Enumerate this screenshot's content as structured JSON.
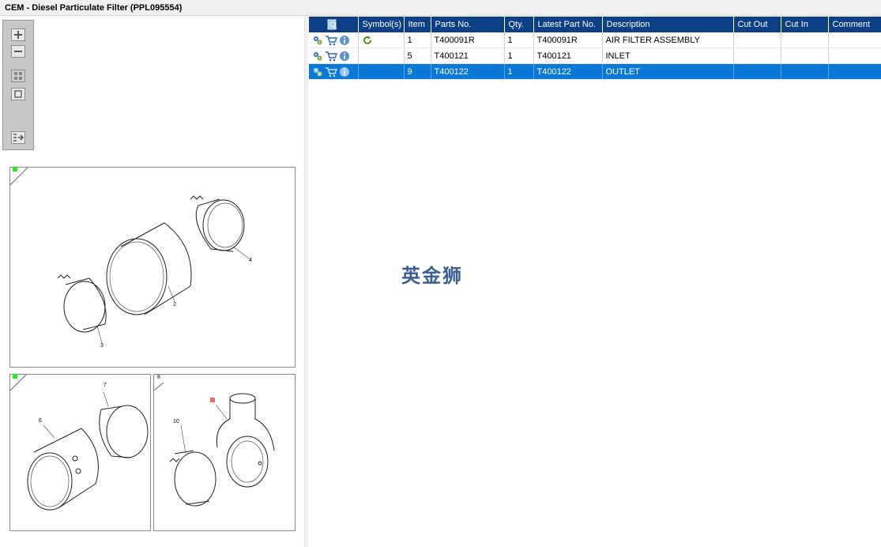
{
  "window": {
    "title": "CEM - Diesel Particulate Filter (PPL095554)"
  },
  "toolbar": {
    "zoom_in_icon": "plus-icon",
    "zoom_out_icon": "minus-icon",
    "fit_all_icon": "grid-icon",
    "fit_one_icon": "square-icon",
    "list_icon": "list-arrow-icon"
  },
  "diagram": {
    "panel1": {
      "callouts": [
        "4",
        "2",
        "3"
      ]
    },
    "panel2": {
      "callouts": [
        "7",
        "6"
      ]
    },
    "panel3": {
      "callouts": [
        "8",
        "10"
      ]
    }
  },
  "table": {
    "headers": [
      "",
      "Symbol(s)",
      "Item",
      "Parts No.",
      "Qty.",
      "Latest Part No.",
      "Description",
      "Cut Out",
      "Cut In",
      "Comment"
    ],
    "rows": [
      {
        "item": "1",
        "part_no": "T400091R",
        "qty": "1",
        "latest": "T400091R",
        "description": "AIR FILTER ASSEMBLY",
        "cut_out": "",
        "cut_in": "",
        "comment": "",
        "symbol": "refresh-icon"
      },
      {
        "item": "5",
        "part_no": "T400121",
        "qty": "1",
        "latest": "T400121",
        "description": "INLET",
        "cut_out": "",
        "cut_in": "",
        "comment": "",
        "symbol": ""
      },
      {
        "item": "9",
        "part_no": "T400122",
        "qty": "1",
        "latest": "T400122",
        "description": "OUTLET",
        "cut_out": "",
        "cut_in": "",
        "comment": "",
        "symbol": ""
      }
    ],
    "selected_row": 2
  },
  "watermark": "英金狮",
  "colors": {
    "header_bg": "#0b3f86",
    "selected_bg": "#0a78d7",
    "marker_green": "#22ee22",
    "marker_red": "#f06a6a"
  }
}
